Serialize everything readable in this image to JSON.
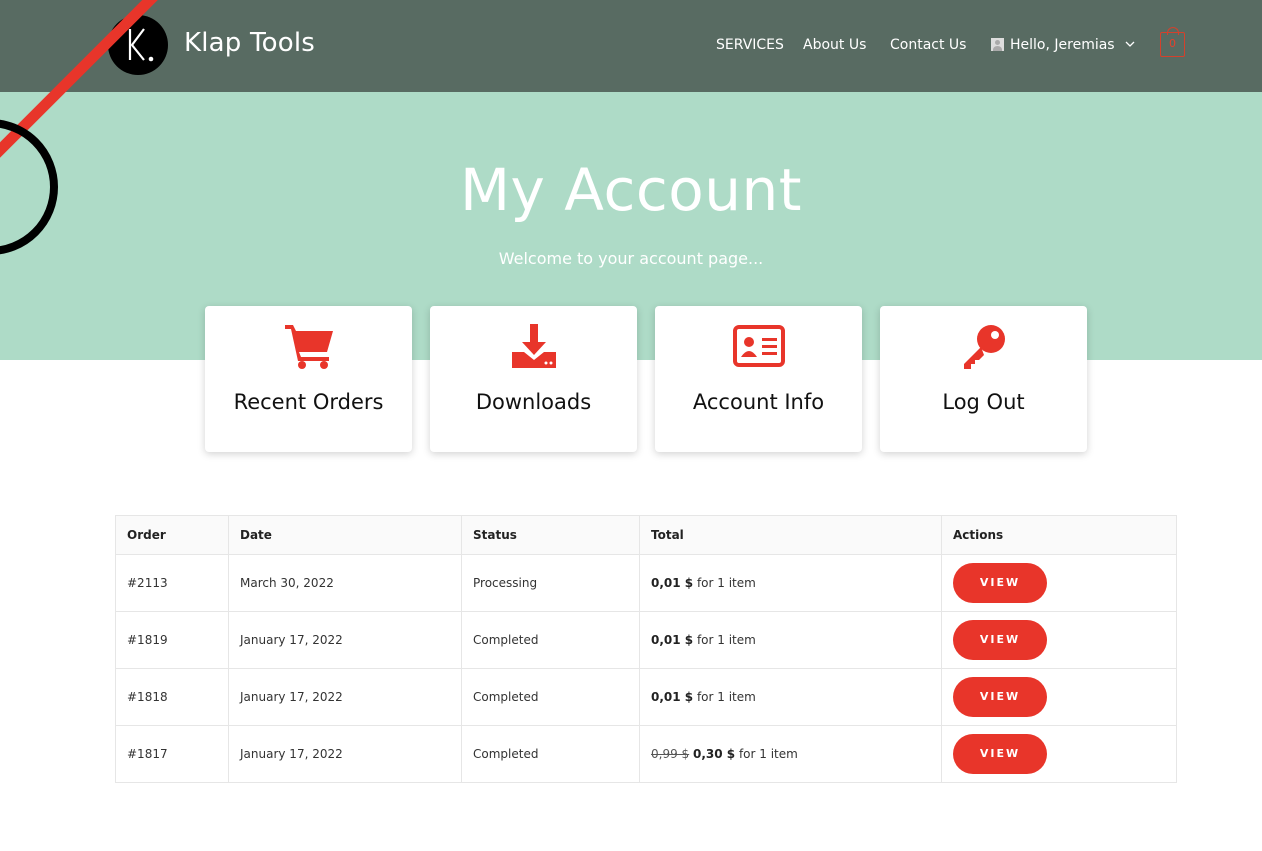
{
  "header": {
    "site_title": "Klap Tools",
    "nav": [
      {
        "label": "SERVICES"
      },
      {
        "label": "About Us"
      },
      {
        "label": "Contact Us"
      }
    ],
    "user_menu_label": "Hello, Jeremias",
    "cart_count": "0",
    "brand_bg_color": "#586b62"
  },
  "hero": {
    "title": "My Account",
    "subtitle": "Welcome to your account page...",
    "bg_color": "#aedbc7"
  },
  "cards": [
    {
      "label": "Recent Orders",
      "icon": "cart-icon"
    },
    {
      "label": "Downloads",
      "icon": "download-icon"
    },
    {
      "label": "Account Info",
      "icon": "id-card-icon"
    },
    {
      "label": "Log Out",
      "icon": "key-icon"
    }
  ],
  "accent_color": "#e8352a",
  "orders": {
    "headers": [
      "Order",
      "Date",
      "Status",
      "Total",
      "Actions"
    ],
    "rows": [
      {
        "order": "#2113",
        "date": "March 30, 2022",
        "status": "Processing",
        "total_old": "",
        "total": "0,01 $",
        "total_suffix": " for 1 item",
        "action": "VIEW"
      },
      {
        "order": "#1819",
        "date": "January 17, 2022",
        "status": "Completed",
        "total_old": "",
        "total": "0,01 $",
        "total_suffix": " for 1 item",
        "action": "VIEW"
      },
      {
        "order": "#1818",
        "date": "January 17, 2022",
        "status": "Completed",
        "total_old": "",
        "total": "0,01 $",
        "total_suffix": " for 1 item",
        "action": "VIEW"
      },
      {
        "order": "#1817",
        "date": "January 17, 2022",
        "status": "Completed",
        "total_old": "0,99 $",
        "total": "0,30 $",
        "total_suffix": " for 1 item",
        "action": "VIEW"
      }
    ]
  }
}
